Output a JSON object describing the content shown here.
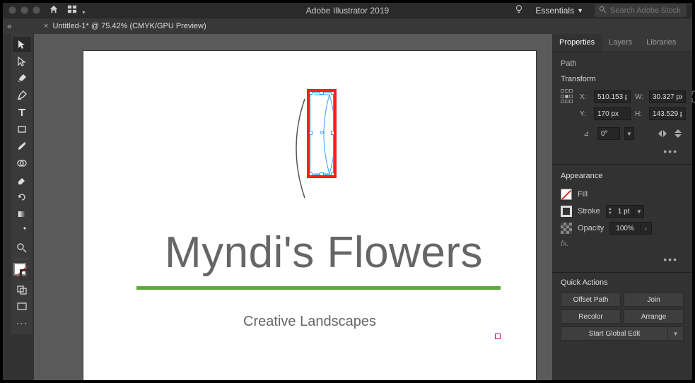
{
  "app_title": "Adobe Illustrator 2019",
  "workspace": "Essentials",
  "search_placeholder": "Search Adobe Stock",
  "doc_tab": "Untitled-1* @ 75.42% (CMYK/GPU Preview)",
  "panel_tabs": [
    "Properties",
    "Layers",
    "Libraries"
  ],
  "selection_type": "Path",
  "sections": {
    "transform": "Transform",
    "appearance": "Appearance",
    "quick_actions": "Quick Actions"
  },
  "transform": {
    "x_label": "X:",
    "x": "510.153 p",
    "y_label": "Y:",
    "y": "170 px",
    "w_label": "W:",
    "w": "30.327 px",
    "h_label": "H:",
    "h": "143.529 p",
    "angle": "0°"
  },
  "appearance": {
    "fill_label": "Fill",
    "stroke_label": "Stroke",
    "stroke_value": "1 pt",
    "opacity_label": "Opacity",
    "opacity_value": "100%",
    "fx_label": "fx."
  },
  "quick_actions": {
    "offset_path": "Offset Path",
    "join": "Join",
    "recolor": "Recolor",
    "arrange": "Arrange",
    "global_edit": "Start Global Edit"
  },
  "artwork": {
    "title": "Myndi's Flowers",
    "subtitle": "Creative Landscapes"
  },
  "colors": {
    "highlight_red": "#ff1e1e",
    "selection_blue": "#3a9bff",
    "green_rule": "#5da83c"
  }
}
